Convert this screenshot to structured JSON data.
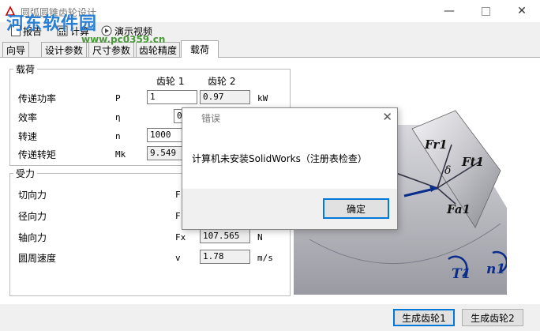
{
  "window": {
    "title": "圆弧圆锥齿轮设计"
  },
  "watermark": {
    "main": "河东软件园",
    "sub": "www.pc0359.cn"
  },
  "toolbar": {
    "items": [
      "报告",
      "计算",
      "演示视频"
    ]
  },
  "tabs": [
    "向导",
    "设计参数",
    "尺寸参数",
    "齿轮精度",
    "载荷"
  ],
  "active_tab": "载荷",
  "load_group": {
    "title": "载荷",
    "col_headers": [
      "齿轮 1",
      "齿轮 2"
    ],
    "rows": [
      {
        "label": "传递功率",
        "symbol": "P",
        "v1": "1",
        "v2": "0.97",
        "unit": "kW"
      },
      {
        "label": "效率",
        "symbol": "η",
        "v1": "0",
        "v2": "",
        "unit": ""
      },
      {
        "label": "转速",
        "symbol": "n",
        "v1": "1000",
        "v2": "",
        "unit": ""
      },
      {
        "label": "传递转矩",
        "symbol": "Mk",
        "v1": "9.549",
        "v2": "",
        "unit": ""
      }
    ]
  },
  "force_group": {
    "title": "受力",
    "rows": [
      {
        "label": "切向力",
        "symbol": "F",
        "value": "",
        "unit": ""
      },
      {
        "label": "径向力",
        "symbol": "F",
        "value": "",
        "unit": ""
      },
      {
        "label": "轴向力",
        "symbol": "Fx",
        "value": "107.565",
        "unit": "N"
      },
      {
        "label": "圆周速度",
        "symbol": "v",
        "value": "1.78",
        "unit": "m/s"
      }
    ]
  },
  "illustration": {
    "labels": [
      "Fr1",
      "Ft1",
      "δ",
      "Fa1",
      "T1",
      "n1"
    ]
  },
  "footer": {
    "btn_gear1": "生成齿轮1",
    "btn_gear2": "生成齿轮2"
  },
  "dialog": {
    "title": "错误",
    "message": "计算机未安装SolidWorks（注册表检查）",
    "ok": "确定"
  }
}
